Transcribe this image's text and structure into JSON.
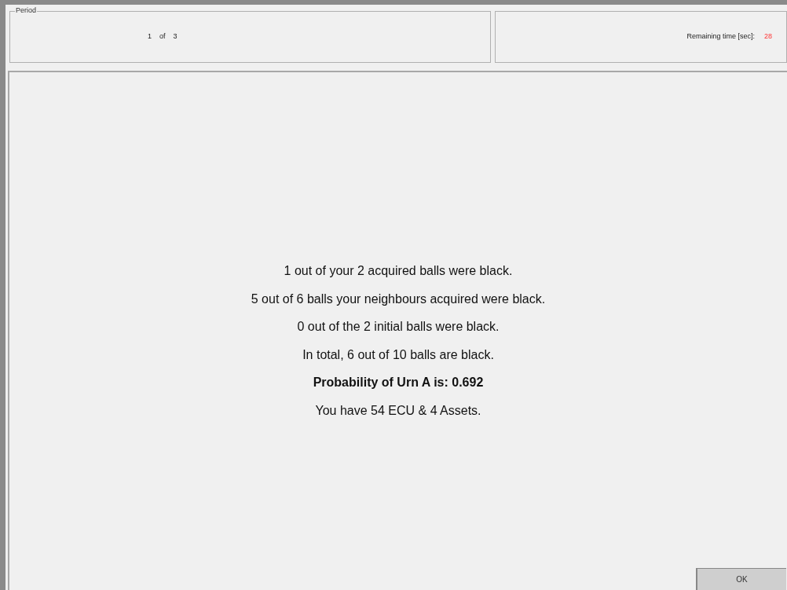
{
  "period": {
    "legend": "Period",
    "current": "1",
    "separator": "of",
    "total": "3"
  },
  "timer": {
    "label": "Remaining time [sec]:",
    "value": "28"
  },
  "messages": [
    {
      "text": "1 out of your 2 acquired balls were black.",
      "kind": "normal"
    },
    {
      "text": "5 out of 6 balls your neighbours acquired were black.",
      "kind": "normal"
    },
    {
      "text": "0 out of the 2 initial balls were black.",
      "kind": "normal"
    },
    {
      "text": "In total, 6 out of 10 balls are black.",
      "kind": "normal"
    },
    {
      "text": "Probability of Urn A is: 0.692",
      "kind": "bold"
    },
    {
      "text": "You have 54 ECU & 4 Assets.",
      "kind": "normal"
    }
  ],
  "button": "OK"
}
